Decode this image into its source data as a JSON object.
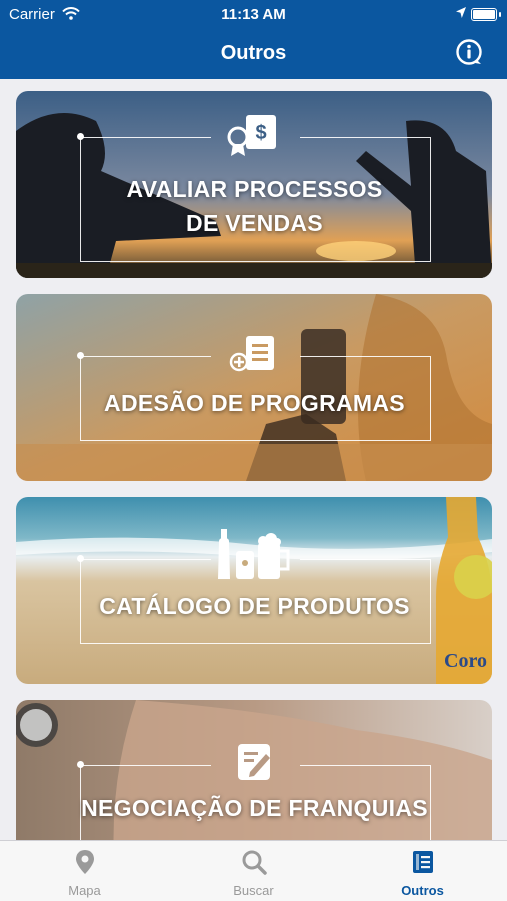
{
  "status_bar": {
    "carrier": "Carrier",
    "time": "11:13 AM"
  },
  "header": {
    "title": "Outros",
    "info_icon": "info-icon"
  },
  "cards": [
    {
      "label_line1": "AVALIAR PROCESSOS",
      "label_line2": "DE VENDAS",
      "icon": "sales-certificate-icon"
    },
    {
      "label": "ADESÃO DE PROGRAMAS",
      "icon": "add-document-icon"
    },
    {
      "label": "CATÁLOGO DE PRODUTOS",
      "icon": "beverages-icon",
      "bottle_text": "Coro"
    },
    {
      "label": "NEGOCIAÇÃO DE FRANQUIAS",
      "icon": "edit-document-icon"
    }
  ],
  "tabbar": {
    "items": [
      {
        "label": "Mapa",
        "icon": "map-pin-icon",
        "active": false
      },
      {
        "label": "Buscar",
        "icon": "search-icon",
        "active": false
      },
      {
        "label": "Outros",
        "icon": "list-document-icon",
        "active": true
      }
    ]
  },
  "colors": {
    "brand": "#0b57a0",
    "tab_inactive": "#9a9a9a"
  }
}
